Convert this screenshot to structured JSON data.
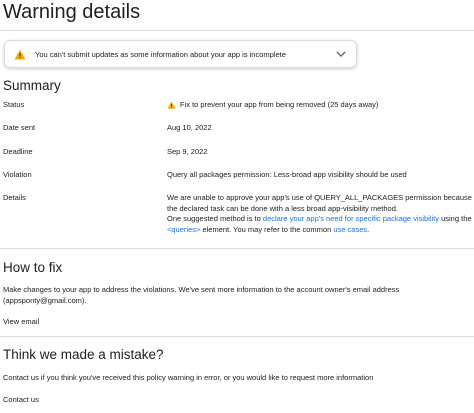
{
  "page": {
    "title": "Warning details"
  },
  "banner": {
    "message": "You can't submit updates as some information about your app is incomplete",
    "icon": "warning-icon",
    "expand_icon": "chevron-down-icon",
    "warning_color": "#f9ab00"
  },
  "summary": {
    "title": "Summary",
    "rows": {
      "status": {
        "label": "Status",
        "value": "Fix to prevent your app from being removed (25 days away)"
      },
      "date_sent": {
        "label": "Date sent",
        "value": "Aug 10, 2022"
      },
      "deadline": {
        "label": "Deadline",
        "value": "Sep 9, 2022"
      },
      "violation": {
        "label": "Violation",
        "value": "Query all packages permission: Less-broad app visibility should be used"
      },
      "details": {
        "label": "Details",
        "text1": "We are unable to approve your app's use of QUERY_ALL_PACKAGES permission because the declared task can be done with a less broad app-visibility method.",
        "text2": "One suggested method is to ",
        "link1": "declare your app's need for specific package visibility",
        "text3": " using the ",
        "link2": "<queries>",
        "text4": " element. You may refer to the common ",
        "link3": "use cases",
        "text5": "."
      }
    }
  },
  "how_to_fix": {
    "title": "How to fix",
    "body": "Make changes to your app to address the violations. We've sent more information to the account owner's email address (appsponty@gmail.com).",
    "link": "View email"
  },
  "mistake": {
    "title": "Think we made a mistake?",
    "body": "Contact us if you think you've received this policy warning in error, or you would like to request more information",
    "link": "Contact us"
  },
  "colors": {
    "link": "#1a73e8",
    "divider": "#dadce0",
    "text": "#202124"
  }
}
